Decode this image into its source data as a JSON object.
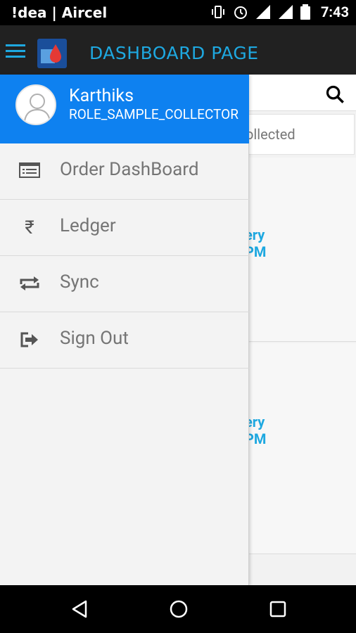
{
  "status_bar": {
    "carrier": "!dea | Aircel",
    "time": "7:43",
    "icons": [
      "vibrate-icon",
      "alarm-icon",
      "signal-icon",
      "signal-icon",
      "battery-icon"
    ]
  },
  "app_bar": {
    "title": "DASHBOARD PAGE",
    "menu_icon": "hamburger-menu-icon",
    "logo": "blood-drop-logo"
  },
  "background": {
    "filter_text": "ollected",
    "cards": [
      {
        "line1": "ery",
        "line2": "PM"
      },
      {
        "line1": "ery",
        "line2": "PM"
      }
    ]
  },
  "drawer": {
    "user_name": "Karthiks",
    "user_role": "ROLE_SAMPLE_COLLECTOR",
    "items": [
      {
        "label": "Order DashBoard",
        "icon": "list-icon"
      },
      {
        "label": "Ledger",
        "icon": "rupee-icon"
      },
      {
        "label": "Sync",
        "icon": "sync-icon"
      },
      {
        "label": "Sign Out",
        "icon": "sign-out-icon"
      }
    ]
  },
  "colors": {
    "accent": "#1ea8e0",
    "drawer_header": "#0e81f0",
    "app_bar": "#212121"
  }
}
